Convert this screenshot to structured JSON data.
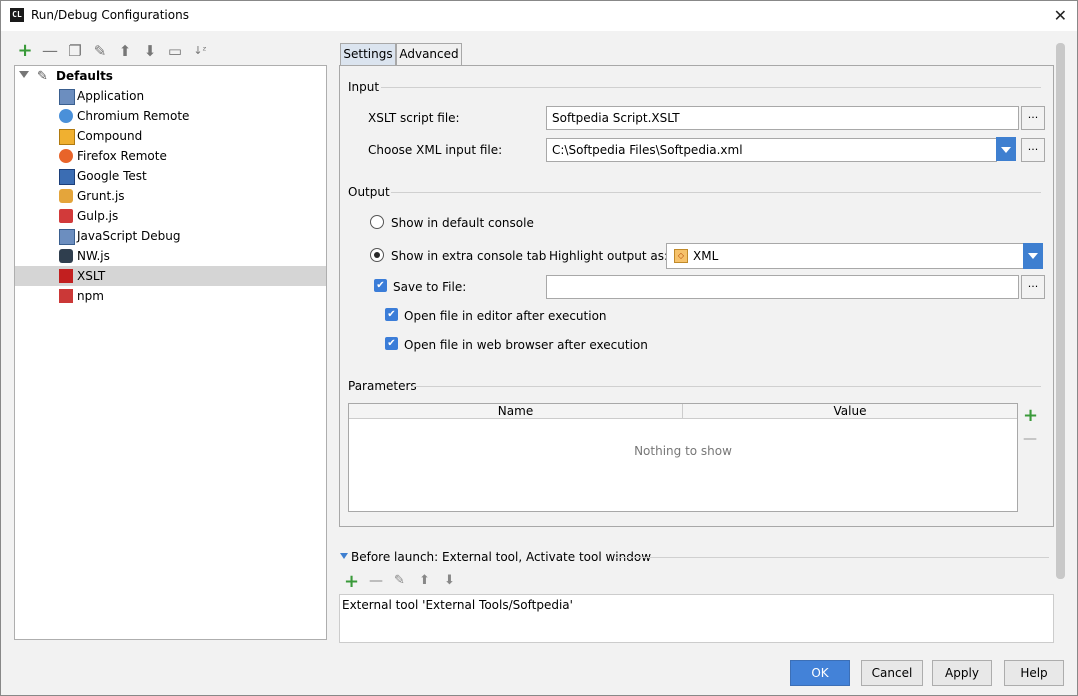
{
  "window": {
    "title": "Run/Debug Configurations",
    "app_icon_text": "CL"
  },
  "left": {
    "toolbar": [
      "add",
      "remove",
      "copy",
      "edit-defaults",
      "move-up",
      "move-down",
      "folder",
      "sort"
    ],
    "tree": {
      "root": "Defaults",
      "items": [
        {
          "label": "Application",
          "icon": "application-icon"
        },
        {
          "label": "Chromium Remote",
          "icon": "chromium-icon"
        },
        {
          "label": "Compound",
          "icon": "compound-icon"
        },
        {
          "label": "Firefox Remote",
          "icon": "firefox-icon"
        },
        {
          "label": "Google Test",
          "icon": "google-test-icon"
        },
        {
          "label": "Grunt.js",
          "icon": "grunt-icon"
        },
        {
          "label": "Gulp.js",
          "icon": "gulp-icon"
        },
        {
          "label": "JavaScript Debug",
          "icon": "javascript-debug-icon"
        },
        {
          "label": "NW.js",
          "icon": "nwjs-icon"
        },
        {
          "label": "XSLT",
          "icon": "xslt-icon"
        },
        {
          "label": "npm",
          "icon": "npm-icon"
        }
      ],
      "selected": "XSLT"
    }
  },
  "tabs": [
    {
      "label": "Settings"
    },
    {
      "label": "Advanced"
    }
  ],
  "input": {
    "section": "Input",
    "xslt_label": "XSLT script file:",
    "xslt_value": "Softpedia Script.XSLT",
    "xml_label": "Choose XML input file:",
    "xml_value": "C:\\Softpedia Files\\Softpedia.xml",
    "browse": "..."
  },
  "output": {
    "section": "Output",
    "default_console": "Show in default console",
    "extra_tab": "Show in extra console tab",
    "highlight_label": "Highlight output as:",
    "highlight_value": "XML",
    "save_to_file": "Save to File:",
    "open_editor": "Open file in editor after execution",
    "open_browser": "Open file in web browser after execution"
  },
  "parameters": {
    "section": "Parameters",
    "col_name": "Name",
    "col_value": "Value",
    "empty": "Nothing to show"
  },
  "before_launch": {
    "header": "Before launch: External tool, Activate tool window",
    "item": "External tool 'External Tools/Softpedia'"
  },
  "buttons": {
    "ok": "OK",
    "cancel": "Cancel",
    "apply": "Apply",
    "help": "Help"
  },
  "colors": {
    "primary": "#4382d8",
    "selected_row": "#d5d5d5",
    "accent_blue": "#3e7fd0"
  }
}
